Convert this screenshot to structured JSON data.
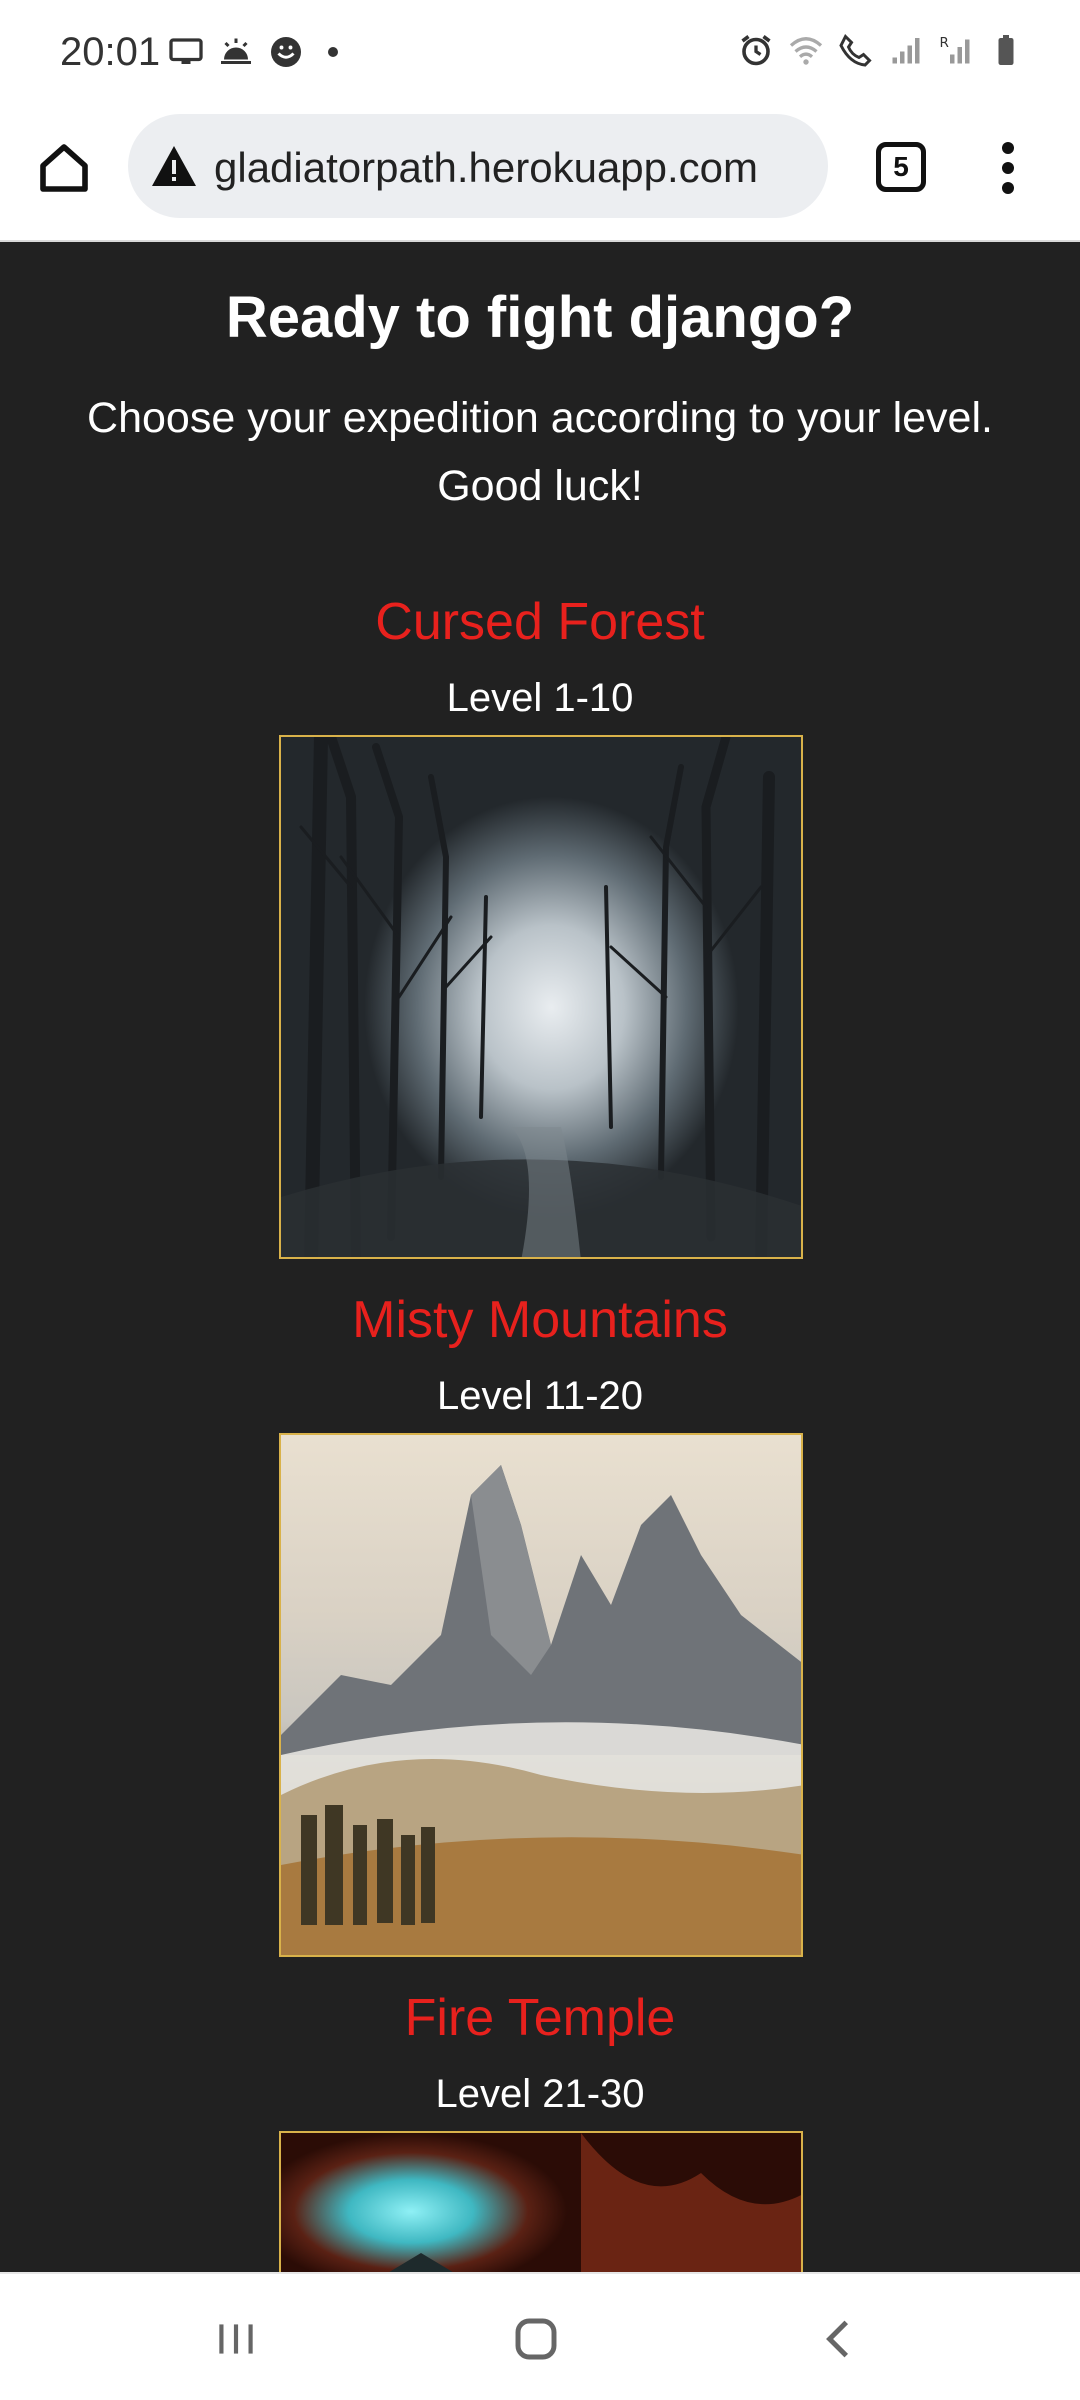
{
  "status_bar": {
    "time": "20:01",
    "left_icons": [
      "monitor-icon",
      "weather-icon",
      "face-icon",
      "dot-icon"
    ],
    "right_icons": [
      "alarm-icon",
      "wifi-icon",
      "wifi-call-icon",
      "signal-icon",
      "signal-roaming-icon",
      "battery-icon"
    ]
  },
  "browser": {
    "url": "gladiatorpath.herokuapp.com",
    "tab_count": "5"
  },
  "hero": {
    "title": "Ready to fight django?",
    "subtitle": "Choose your expedition according to your level. Good luck!"
  },
  "expeditions": [
    {
      "name": "Cursed Forest",
      "level": "Level 1-10",
      "image": "cursed-forest-image"
    },
    {
      "name": "Misty Mountains",
      "level": "Level 11-20",
      "image": "misty-mountains-image"
    },
    {
      "name": "Fire Temple",
      "level": "Level 21-30",
      "image": "fire-temple-image"
    }
  ],
  "colors": {
    "background": "#212121",
    "expedition_title": "#e8211d",
    "image_border": "#d9b24a"
  }
}
